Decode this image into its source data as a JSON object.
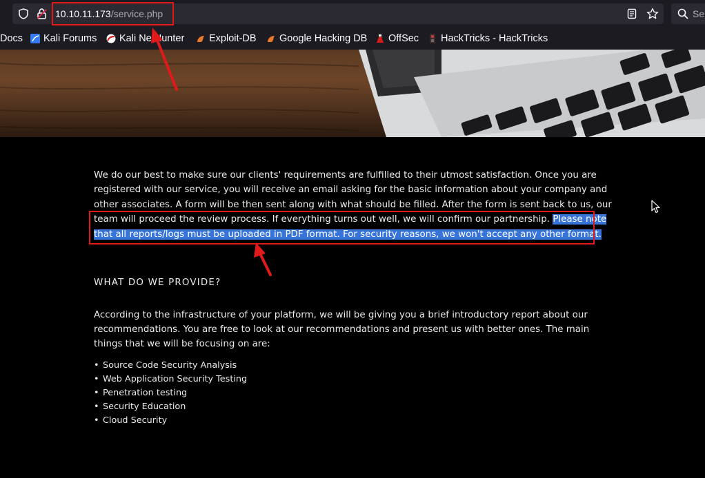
{
  "browser": {
    "url_host": "10.10.11.173",
    "url_path": "/service.php",
    "search_placeholder": "Se"
  },
  "bookmarks": [
    {
      "label": "Docs",
      "icon": "docs-icon"
    },
    {
      "label": "Kali Forums",
      "icon": "kali-icon"
    },
    {
      "label": "Kali NetHunter",
      "icon": "nethunter-icon"
    },
    {
      "label": "Exploit-DB",
      "icon": "exploitdb-icon"
    },
    {
      "label": "Google Hacking DB",
      "icon": "ghdb-icon"
    },
    {
      "label": "OffSec",
      "icon": "offsec-icon"
    },
    {
      "label": "HackTricks - HackTricks",
      "icon": "hacktricks-icon"
    }
  ],
  "page": {
    "intro_plain": "We do our best to make sure our clients' requirements are fulfilled to their utmost satisfaction. Once you are registered with our service, you will receive an email asking for the basic information about your company and other associates. A form will be then sent along with what should be filled. After the form is sent back to us, our team will proceed the review process. If everything turns out well, we will confirm our partnership. ",
    "intro_highlight": "Please note that all reports/logs must be uploaded in PDF format. For security reasons, we won't accept any other format.",
    "heading": "WHAT DO WE PROVIDE?",
    "provide_text": "According to the infrastructure of your platform, we will be giving you a brief introductory report about our recommendations. You are free to look at our recommendations and present us with better ones. The main things that we will be focusing on are:",
    "services": [
      "Source Code Security Analysis",
      "Web Application Security Testing",
      "Penetration testing",
      "Security Education",
      "Cloud Security"
    ]
  },
  "colors": {
    "annotation": "#e01a1a",
    "selection": "#3874d8"
  }
}
